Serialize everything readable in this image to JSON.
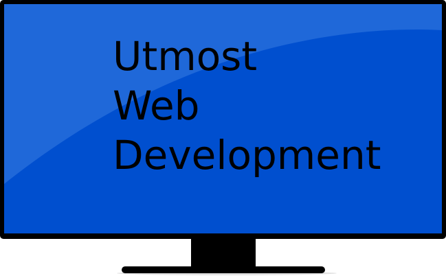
{
  "screen": {
    "lines": [
      "Utmost",
      "Web",
      "Development"
    ],
    "background_color": "#004fcf",
    "gloss_color": "#1f68d9",
    "text_color": "#000000"
  },
  "monitor": {
    "bezel_color": "#000000"
  }
}
